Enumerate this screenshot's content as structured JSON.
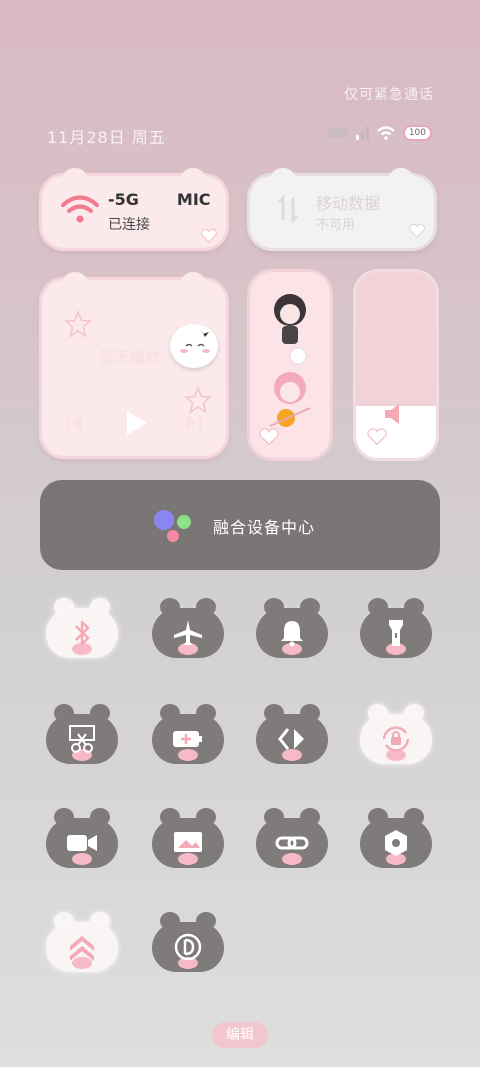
{
  "status_bar": {
    "emergency_text": "仅可紧急通话",
    "date": "11月28日 周五",
    "battery": "100"
  },
  "wifi_tile": {
    "title": "-5G",
    "title_right": "MIC",
    "status": "已连接",
    "accent": "#f27c8f"
  },
  "mobile_tile": {
    "title": "移动数据",
    "status": "不可用"
  },
  "media_tile": {
    "text": "暂无播放"
  },
  "fusion": {
    "label": "融合设备中心"
  },
  "toggles": [
    {
      "name": "bluetooth",
      "style": "white",
      "icon": "bluetooth-icon"
    },
    {
      "name": "airplane",
      "style": "grey",
      "icon": "airplane-icon"
    },
    {
      "name": "bell",
      "style": "grey",
      "icon": "bell-icon"
    },
    {
      "name": "flashlight",
      "style": "grey",
      "icon": "flashlight-icon"
    },
    {
      "name": "screenshot",
      "style": "grey",
      "icon": "scissors-icon"
    },
    {
      "name": "battery-saver",
      "style": "grey",
      "icon": "battery-plus-icon"
    },
    {
      "name": "share",
      "style": "grey",
      "icon": "share-icon"
    },
    {
      "name": "rotation-lock",
      "style": "white",
      "icon": "rotation-lock-icon"
    },
    {
      "name": "screen-record",
      "style": "grey",
      "icon": "video-camera-icon"
    },
    {
      "name": "projection",
      "style": "grey",
      "icon": "screen-cast-icon"
    },
    {
      "name": "link",
      "style": "grey",
      "icon": "link-icon"
    },
    {
      "name": "settings",
      "style": "grey",
      "icon": "gear-icon"
    },
    {
      "name": "performance",
      "style": "white",
      "icon": "chevrons-up-icon"
    },
    {
      "name": "nfc",
      "style": "grey",
      "icon": "nfc-icon"
    }
  ],
  "footer": {
    "edit_label": "编辑"
  }
}
